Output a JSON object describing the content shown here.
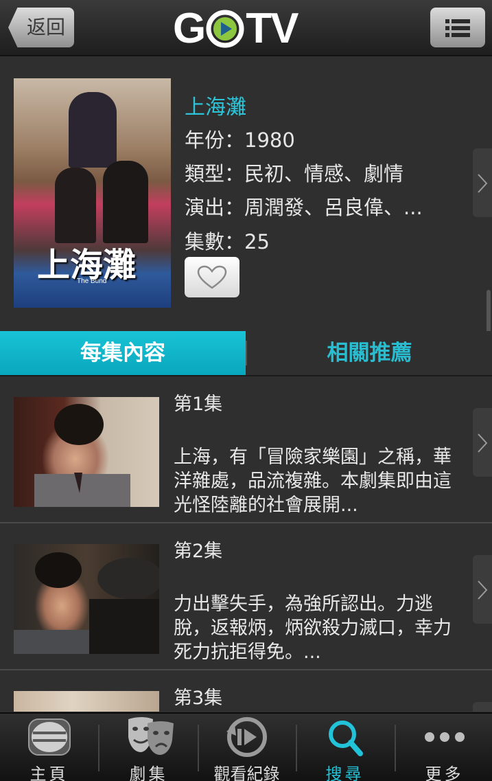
{
  "header": {
    "back_label": "返回",
    "logo_text_left": "G",
    "logo_text_right": "TV",
    "menu_icon": "list-icon"
  },
  "show": {
    "title": "上海灘",
    "year_label": "年份：",
    "year": "1980",
    "genre_label": "類型：",
    "genre": "民初、情感、劇情",
    "cast_label": "演出：",
    "cast": "周潤發、呂良偉、...",
    "episodes_label": "集數：",
    "episodes": "25",
    "poster_title": "上海灘",
    "poster_subtitle": "The Bund"
  },
  "tabs": [
    {
      "label": "每集內容",
      "active": true
    },
    {
      "label": "相關推薦",
      "active": false
    }
  ],
  "episode_list": [
    {
      "title": "第1集",
      "desc": "上海，有「冒險家樂園」之稱，華洋雜處，品流複雜。本劇集即由這光怪陸離的社會展開..."
    },
    {
      "title": "第2集",
      "desc": "力出擊失手，為強所認出。力逃脫，返報炳，炳欲殺力滅口，幸力死力抗拒得免。..."
    },
    {
      "title": "第3集",
      "desc": ""
    }
  ],
  "bottom_nav": [
    {
      "label": "主頁",
      "icon": "home-icon",
      "active": false
    },
    {
      "label": "劇集",
      "icon": "drama-masks-icon",
      "active": false
    },
    {
      "label": "觀看紀錄",
      "icon": "history-icon",
      "active": false
    },
    {
      "label": "搜尋",
      "icon": "search-icon",
      "active": true
    },
    {
      "label": "更多",
      "icon": "more-icon",
      "active": false
    }
  ],
  "colors": {
    "accent": "#1cc0d5",
    "background": "#2f2f2f",
    "logo_green": "#8dc63f"
  }
}
